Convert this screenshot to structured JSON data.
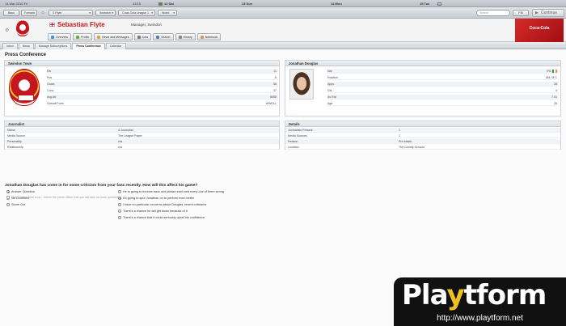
{
  "calendar": {
    "today": "14 Mar 2010 Fri",
    "time": "13:15",
    "days": [
      {
        "label": "12 Sat"
      },
      {
        "label": "13 Sun"
      },
      {
        "label": "14 Mon"
      },
      {
        "label": "15 Tue"
      }
    ]
  },
  "toolbar": {
    "back": "Back",
    "forward": "Forward",
    "manager_select": "S Flyte",
    "club_select": "Swindon",
    "competition_select": "Coca-Cola League 1",
    "world_select": "World",
    "search_placeholder": "Search",
    "fm_menu": "FM",
    "continue": "Continue"
  },
  "header": {
    "name": "Sebastian Flyte",
    "role": "Manager, Swindon",
    "tabs": [
      {
        "label": "Overview",
        "icon": "overview-icon",
        "color": "#4a8fd6"
      },
      {
        "label": "Profile",
        "icon": "profile-icon",
        "color": "#6aa84f"
      },
      {
        "label": "News and Messages",
        "icon": "news-icon",
        "color": "#d9a44a"
      },
      {
        "label": "Jobs",
        "icon": "jobs-icon",
        "color": "#777777"
      },
      {
        "label": "Search",
        "icon": "search-icon",
        "color": "#5a7fa8"
      },
      {
        "label": "History",
        "icon": "history-icon",
        "color": "#888888"
      },
      {
        "label": "Notebook",
        "icon": "notebook-icon",
        "color": "#c8a05a"
      }
    ],
    "banner_text": "Coca-Cola"
  },
  "subnav": {
    "tabs": [
      "Inbox",
      "News",
      "Manage Subscriptions",
      "Press Conference",
      "Calendar"
    ],
    "active": "Press Conference"
  },
  "page": {
    "title": "Press Conference"
  },
  "club_panel": {
    "title": "Swindon Town",
    "rows": [
      {
        "label": "Div",
        "value": "11"
      },
      {
        "label": "Pos",
        "value": "6"
      },
      {
        "label": "Goals",
        "value": "58"
      },
      {
        "label": "Conc",
        "value": "47"
      },
      {
        "label": "Avg Att",
        "value": "6558"
      },
      {
        "label": "Overall Form",
        "value": "WWDLL"
      }
    ]
  },
  "player_panel": {
    "title": "Jonathan Douglas",
    "rows": [
      {
        "label": "Nat",
        "value": "IRL"
      },
      {
        "label": "Position",
        "value": "DM, M C"
      },
      {
        "label": "Apps",
        "value": "28"
      },
      {
        "label": "Gls",
        "value": "4"
      },
      {
        "label": "Av Rat",
        "value": "7.01"
      },
      {
        "label": "Age",
        "value": "28"
      }
    ]
  },
  "journalist_panel": {
    "title": "Journalist",
    "rows": [
      {
        "label": "Name",
        "value": "A Journalist"
      },
      {
        "label": "Media Source",
        "value": "The League Paper"
      },
      {
        "label": "Personality",
        "value": "n/a"
      },
      {
        "label": "Relationship",
        "value": "n/a"
      }
    ]
  },
  "details_panel": {
    "title": "Details",
    "rows": [
      {
        "label": "Journalists Present",
        "value": "1"
      },
      {
        "label": "Media Sources",
        "value": "1"
      },
      {
        "label": "Reason",
        "value": "Pre Match"
      },
      {
        "label": "Location",
        "value": "The County Ground"
      }
    ]
  },
  "question": {
    "text": "Jonathan Douglas has come in for some criticism from your fans recently. How will this affect his game?",
    "left_options": [
      {
        "label": "Answer Question",
        "selected": true
      },
      {
        "label": "No Comment",
        "selected": false
      },
      {
        "label": "Storm Out",
        "selected": false
      }
    ],
    "answers": [
      {
        "label": "He is going to bounce back and please each and every one of them wrong",
        "selected": false
      },
      {
        "label": "It's going to spur Jonathan on to perform even better",
        "selected": true
      },
      {
        "label": "I have no particular concerns about Douglas' recent criticisms",
        "selected": false
      },
      {
        "label": "There's a chance he will get down because of it",
        "selected": false
      },
      {
        "label": "There's a chance that it could seriously upset his confidence",
        "selected": false
      }
    ],
    "hint": "The whistled time is up - Inform the press officer that you will take no more questions"
  },
  "watermark": {
    "logo_pre": "Pla",
    "logo_hl": "y",
    "logo_post": "tform",
    "url": "http://www.playtform.net"
  }
}
